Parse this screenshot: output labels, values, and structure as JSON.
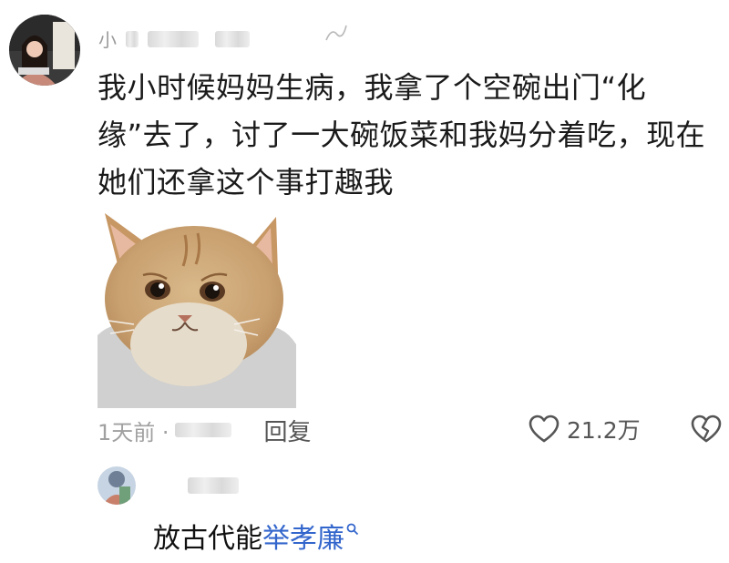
{
  "comment": {
    "username_visible": "小",
    "text": "我小时候妈妈生病，我拿了个空碗出门“化缘”去了，讨了一大碗饭菜和我妈分着吃，现在她们还拿这个事打趣我",
    "time": "1天前 ·",
    "reply_label": "回复",
    "like_count": "21.2万"
  },
  "reply": {
    "text_plain": "放古代能",
    "text_link": "举孝廉"
  },
  "icons": {
    "like": "heart-outline-icon",
    "dislike": "broken-heart-icon",
    "search": "search-icon"
  },
  "colors": {
    "link": "#3366cc",
    "meta_gray": "#a0a0a0"
  }
}
